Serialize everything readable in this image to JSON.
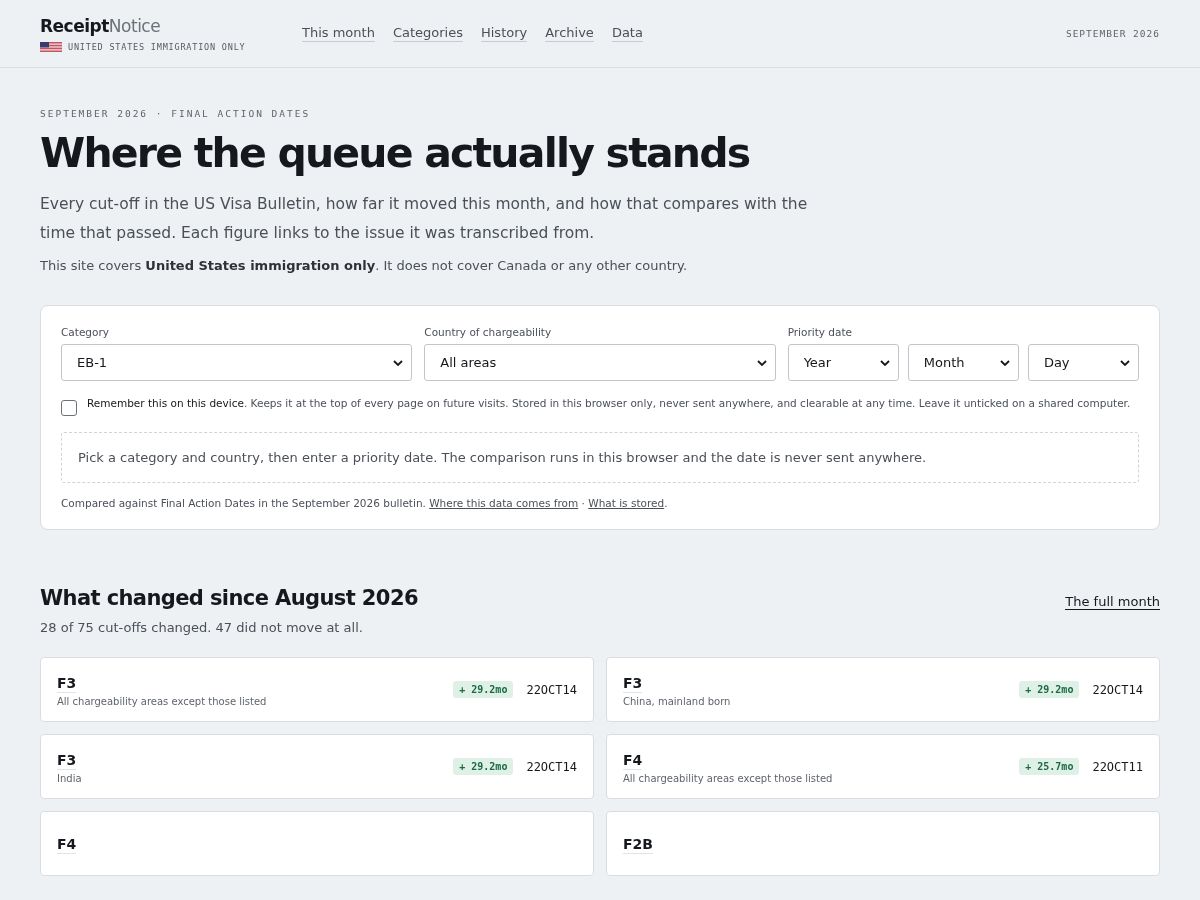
{
  "header": {
    "brand_bold": "Receipt",
    "brand_light": "Notice",
    "tagline": "UNITED STATES IMMIGRATION ONLY",
    "nav": [
      {
        "label": "This month"
      },
      {
        "label": "Categories"
      },
      {
        "label": "History"
      },
      {
        "label": "Archive"
      },
      {
        "label": "Data"
      }
    ],
    "date": "SEPTEMBER 2026"
  },
  "hero": {
    "eyebrow": "SEPTEMBER 2026 · FINAL ACTION DATES",
    "title": "Where the queue actually stands",
    "lead": "Every cut-off in the US Visa Bulletin, how far it moved this month, and how that compares with the time that passed. Each figure links to the issue it was transcribed from.",
    "note": "This site covers **United States immigration only**. It does not cover Canada or any other country."
  },
  "form": {
    "fields": [
      {
        "label": "Category",
        "selects": [
          {
            "value": "EB-1"
          }
        ]
      },
      {
        "label": "Country of chargeability",
        "selects": [
          {
            "value": "All areas"
          }
        ]
      },
      {
        "label": "Priority date",
        "selects": [
          {
            "value": "Year"
          },
          {
            "value": "Month"
          },
          {
            "value": "Day"
          }
        ]
      }
    ],
    "remember": {
      "checked": false,
      "text": "**Remember this on this device**. Keeps it at the top of every page on future visits. Stored in this browser only, never sent anywhere, and clearable at any time. Leave it unticked on a shared computer."
    },
    "result": "Pick a category and country, then enter a priority date. The comparison runs in this browser and the date is never sent anywhere.",
    "source_text": "Compared against Final Action Dates in the September 2026 bulletin.",
    "links": [
      "Where this data comes from",
      "What is stored"
    ],
    "link_separator": "·",
    "end_mark": "."
  },
  "changes": {
    "title": "What changed since August 2026",
    "link": "The full month",
    "summary": "28 of 75 cut-offs changed. 47 did not move at all.",
    "cards": [
      {
        "category": "F3",
        "area": "All chargeability areas except those listed",
        "change": "+ 29.2mo",
        "date": "22OCT14"
      },
      {
        "category": "F3",
        "area": "China, mainland born",
        "change": "+ 29.2mo",
        "date": "22OCT14"
      },
      {
        "category": "F3",
        "area": "India",
        "change": "+ 29.2mo",
        "date": "22OCT14"
      },
      {
        "category": "F4",
        "area": "All chargeability areas except those listed",
        "change": "+ 25.7mo",
        "date": "22OCT11"
      },
      {
        "category": "F4"
      },
      {
        "category": "F2B"
      }
    ]
  }
}
